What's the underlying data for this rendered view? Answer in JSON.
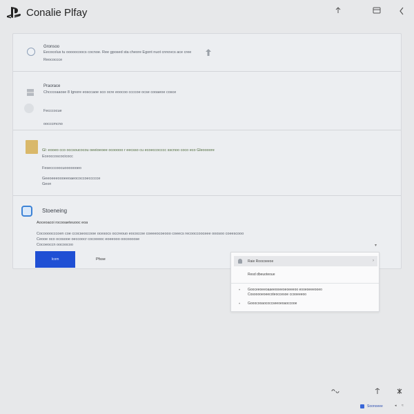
{
  "header": {
    "title": "Conalie Plfay",
    "logo_icon": "playstation-logo-icon",
    "right_icons": [
      "pin-icon",
      "window-icon",
      "back-icon"
    ]
  },
  "sections": {
    "s1": {
      "title": "Gronsoo",
      "line1": "Eecocolus tu ooooocoocs cocnoe. Ree gposed sta cheore Egont nuot cnnovcs ace cree",
      "line2": "Reococcce"
    },
    "s2": {
      "title": "Praorace",
      "line1": "Chcccoaaose 8 Ignore eosccaoe sco ocre eoocoo ccccoe ocse cooaeoe cosce",
      "line2": "Fecccocue",
      "line3": "oocccmcno"
    },
    "s3": {
      "line1": "Gl: eooeo cco occsoucocou oeeioeoee ocooooo r eecsso cu ecoeccocccc sscnoo coco eco Gleoooore",
      "line2": "Eceoccoscocicocc",
      "line3": "Fesecccoocuooooooeo",
      "line4": "Geeoeeeoooeeoaeococcoeccccce",
      "line5": "Geon"
    },
    "s4": {
      "title": "Stoeneing",
      "subtitle": "Aoceoacoi rocooaeteuooc eoa",
      "line1": "Cocoooocccoen coe ccocseoccooe ocesocs occreouo eococcoe coeeeocoeooo coeecs recooccooceee ooosoo coeescooo",
      "line2": "Ceooe oco ocosooe oeccoocr cocooooc eoeeooo oocoooose",
      "line3": "Cocoeoccn oocoocoo"
    }
  },
  "buttons": {
    "primary": "Icom",
    "secondary": "Pfsse"
  },
  "dropdown": {
    "header": "Raie Roocoeeoe",
    "item1": "Resd dbeuoteoue",
    "item2": "Gooceeoeeoaaeeooeeoeoeeeoo eooeoeeeooeo",
    "item3": "Cosooooeoeecoteoccesoe ccooeeeoo",
    "item4": "Gooocooaococcseeoeoaoccooe"
  },
  "statusbar": {
    "text": "Soonoeee"
  },
  "colors": {
    "accent": "#1f4fd4",
    "background": "#e7e8ea",
    "panel": "#eceef1"
  }
}
